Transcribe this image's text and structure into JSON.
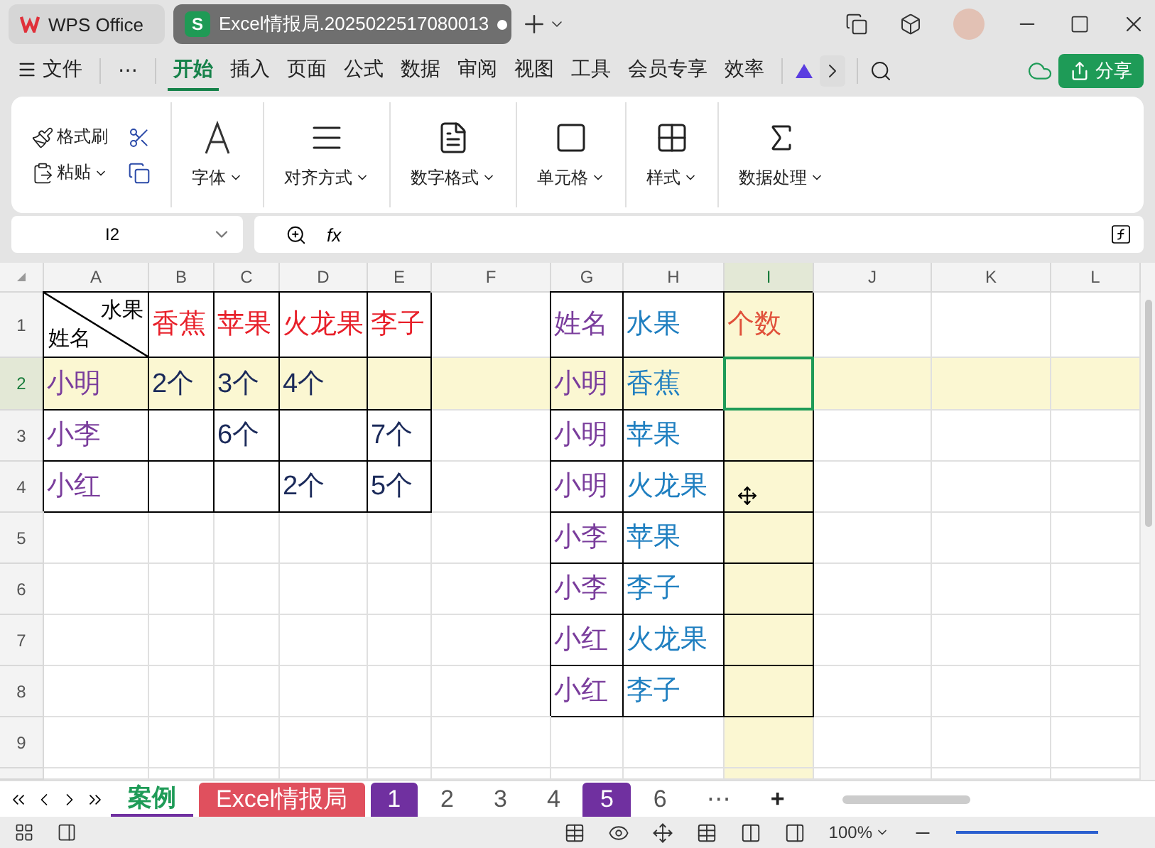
{
  "title_bar": {
    "home_tab": "WPS Office",
    "doc_tab": {
      "icon_letter": "S",
      "title": "Excel情报局.2025022517080013",
      "unsaved": true
    }
  },
  "menu": {
    "file": "文件",
    "more": "⋯",
    "tabs": [
      {
        "label": "开始",
        "selected": true
      },
      {
        "label": "插入",
        "selected": false
      },
      {
        "label": "页面",
        "selected": false
      },
      {
        "label": "公式",
        "selected": false
      },
      {
        "label": "数据",
        "selected": false
      },
      {
        "label": "审阅",
        "selected": false
      },
      {
        "label": "视图",
        "selected": false
      },
      {
        "label": "工具",
        "selected": false
      },
      {
        "label": "会员专享",
        "selected": false
      },
      {
        "label": "效率",
        "selected": false
      }
    ],
    "share": "分享"
  },
  "ribbon": {
    "groups": [
      {
        "kind": "clipboard",
        "items": [
          "格式刷",
          "粘贴"
        ]
      },
      {
        "kind": "font",
        "label": "字体"
      },
      {
        "kind": "align",
        "label": "对齐方式"
      },
      {
        "kind": "number",
        "label": "数字格式"
      },
      {
        "kind": "cell",
        "label": "单元格"
      },
      {
        "kind": "style",
        "label": "样式"
      },
      {
        "kind": "data",
        "label": "数据处理"
      }
    ]
  },
  "formula_bar": {
    "name_box": "I2",
    "fx": "fx"
  },
  "sheet": {
    "columns": [
      {
        "label": "A",
        "selected": false
      },
      {
        "label": "B",
        "selected": false
      },
      {
        "label": "C",
        "selected": false
      },
      {
        "label": "D",
        "selected": false
      },
      {
        "label": "E",
        "selected": false
      },
      {
        "label": "F",
        "selected": false
      },
      {
        "label": "G",
        "selected": false
      },
      {
        "label": "H",
        "selected": false
      },
      {
        "label": "I",
        "selected": true
      },
      {
        "label": "J",
        "selected": false
      },
      {
        "label": "K",
        "selected": false
      },
      {
        "label": "L",
        "selected": false
      }
    ],
    "rows": [
      {
        "label": "1",
        "selected": false,
        "cells": [
          {
            "kind": "diagonal",
            "top": "水果",
            "bottom": "姓名",
            "bordered": true
          },
          {
            "text": "香蕉",
            "color": "#e8202a",
            "bordered": true
          },
          {
            "text": "苹果",
            "color": "#e8202a",
            "bordered": true
          },
          {
            "text": "火龙果",
            "color": "#e8202a",
            "bordered": true
          },
          {
            "text": "李子",
            "color": "#e8202a",
            "bordered": true
          },
          {
            "text": ""
          },
          {
            "text": "姓名",
            "color": "#7a3d9c",
            "bordered": true
          },
          {
            "text": "水果",
            "color": "#1f7fc0",
            "bordered": true
          },
          {
            "text": "个数",
            "color": "#e0503a",
            "bordered": true
          },
          {
            "text": ""
          },
          {
            "text": ""
          },
          {
            "text": ""
          }
        ]
      },
      {
        "label": "2",
        "selected": true,
        "cells": [
          {
            "text": "小明",
            "color": "#7a3d9c",
            "bordered": true
          },
          {
            "text": "2个",
            "color": "#1b2a5a",
            "bordered": true
          },
          {
            "text": "3个",
            "color": "#1b2a5a",
            "bordered": true
          },
          {
            "text": "4个",
            "color": "#1b2a5a",
            "bordered": true
          },
          {
            "text": "",
            "bordered": true
          },
          {
            "text": ""
          },
          {
            "text": "小明",
            "color": "#7a3d9c",
            "bordered": true
          },
          {
            "text": "香蕉",
            "color": "#1f7fc0",
            "bordered": true
          },
          {
            "text": "",
            "bordered": true
          },
          {
            "text": ""
          },
          {
            "text": ""
          },
          {
            "text": ""
          }
        ]
      },
      {
        "label": "3",
        "selected": false,
        "cells": [
          {
            "text": "小李",
            "color": "#7a3d9c",
            "bordered": true
          },
          {
            "text": "",
            "bordered": true
          },
          {
            "text": "6个",
            "color": "#1b2a5a",
            "bordered": true
          },
          {
            "text": "",
            "bordered": true
          },
          {
            "text": "7个",
            "color": "#1b2a5a",
            "bordered": true
          },
          {
            "text": ""
          },
          {
            "text": "小明",
            "color": "#7a3d9c",
            "bordered": true
          },
          {
            "text": "苹果",
            "color": "#1f7fc0",
            "bordered": true
          },
          {
            "text": "",
            "bordered": true
          },
          {
            "text": ""
          },
          {
            "text": ""
          },
          {
            "text": ""
          }
        ]
      },
      {
        "label": "4",
        "selected": false,
        "cells": [
          {
            "text": "小红",
            "color": "#7a3d9c",
            "bordered": true
          },
          {
            "text": "",
            "bordered": true
          },
          {
            "text": "",
            "bordered": true
          },
          {
            "text": "2个",
            "color": "#1b2a5a",
            "bordered": true
          },
          {
            "text": "5个",
            "color": "#1b2a5a",
            "bordered": true
          },
          {
            "text": ""
          },
          {
            "text": "小明",
            "color": "#7a3d9c",
            "bordered": true
          },
          {
            "text": "火龙果",
            "color": "#1f7fc0",
            "bordered": true
          },
          {
            "text": "",
            "bordered": true
          },
          {
            "text": ""
          },
          {
            "text": ""
          },
          {
            "text": ""
          }
        ]
      },
      {
        "label": "5",
        "selected": false,
        "cells": [
          {
            "text": ""
          },
          {
            "text": ""
          },
          {
            "text": ""
          },
          {
            "text": ""
          },
          {
            "text": ""
          },
          {
            "text": ""
          },
          {
            "text": "小李",
            "color": "#7a3d9c",
            "bordered": true
          },
          {
            "text": "苹果",
            "color": "#1f7fc0",
            "bordered": true
          },
          {
            "text": "",
            "bordered": true
          },
          {
            "text": ""
          },
          {
            "text": ""
          },
          {
            "text": ""
          }
        ]
      },
      {
        "label": "6",
        "selected": false,
        "cells": [
          {
            "text": ""
          },
          {
            "text": ""
          },
          {
            "text": ""
          },
          {
            "text": ""
          },
          {
            "text": ""
          },
          {
            "text": ""
          },
          {
            "text": "小李",
            "color": "#7a3d9c",
            "bordered": true
          },
          {
            "text": "李子",
            "color": "#1f7fc0",
            "bordered": true
          },
          {
            "text": "",
            "bordered": true
          },
          {
            "text": ""
          },
          {
            "text": ""
          },
          {
            "text": ""
          }
        ]
      },
      {
        "label": "7",
        "selected": false,
        "cells": [
          {
            "text": ""
          },
          {
            "text": ""
          },
          {
            "text": ""
          },
          {
            "text": ""
          },
          {
            "text": ""
          },
          {
            "text": ""
          },
          {
            "text": "小红",
            "color": "#7a3d9c",
            "bordered": true
          },
          {
            "text": "火龙果",
            "color": "#1f7fc0",
            "bordered": true
          },
          {
            "text": "",
            "bordered": true
          },
          {
            "text": ""
          },
          {
            "text": ""
          },
          {
            "text": ""
          }
        ]
      },
      {
        "label": "8",
        "selected": false,
        "cells": [
          {
            "text": ""
          },
          {
            "text": ""
          },
          {
            "text": ""
          },
          {
            "text": ""
          },
          {
            "text": ""
          },
          {
            "text": ""
          },
          {
            "text": "小红",
            "color": "#7a3d9c",
            "bordered": true
          },
          {
            "text": "李子",
            "color": "#1f7fc0",
            "bordered": true
          },
          {
            "text": "",
            "bordered": true
          },
          {
            "text": ""
          },
          {
            "text": ""
          },
          {
            "text": ""
          }
        ]
      },
      {
        "label": "9",
        "selected": false,
        "cells": [
          {
            "text": ""
          },
          {
            "text": ""
          },
          {
            "text": ""
          },
          {
            "text": ""
          },
          {
            "text": ""
          },
          {
            "text": ""
          },
          {
            "text": ""
          },
          {
            "text": ""
          },
          {
            "text": ""
          },
          {
            "text": ""
          },
          {
            "text": ""
          },
          {
            "text": ""
          }
        ]
      }
    ]
  },
  "sheet_tabs": [
    {
      "label": "案例",
      "selected": true
    },
    {
      "label": "Excel情报局",
      "selected": false,
      "color": "#e0505e"
    },
    {
      "label": "1",
      "selected": false,
      "color": "#7030a0"
    },
    {
      "label": "2",
      "selected": false
    },
    {
      "label": "3",
      "selected": false
    },
    {
      "label": "4",
      "selected": false
    },
    {
      "label": "5",
      "selected": false,
      "color": "#7030a0"
    },
    {
      "label": "6",
      "selected": false
    }
  ],
  "sheet_more": "⋯",
  "add_sheet": "+",
  "status_bar": {
    "zoom": "100%"
  }
}
